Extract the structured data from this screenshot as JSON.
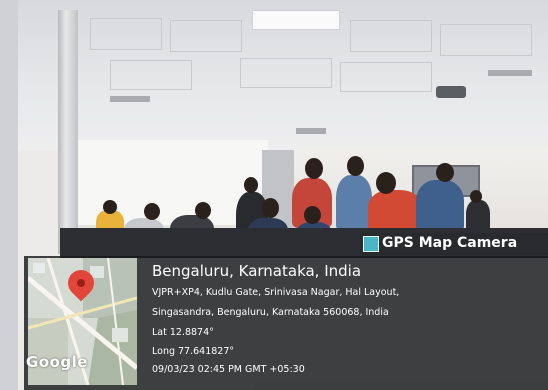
{
  "watermark": {
    "label": "GPS Map Camera"
  },
  "location": {
    "title": "Bengaluru, Karnataka, India",
    "address_line1": "VJPR+XP4, Kudlu Gate, Srinivasa Nagar, Hal Layout,",
    "address_line2": "Singasandra, Bengaluru, Karnataka 560068, India",
    "lat": "Lat 12.8874°",
    "long": "Long 77.641827°",
    "datetime": "09/03/23 02:45 PM GMT +05:30"
  },
  "map": {
    "attribution": "Google",
    "marker_icon": "map-pin-icon"
  },
  "colors": {
    "overlay": "#16181b",
    "pin": "#e2463b",
    "watermark_icon": "#4bb6c8"
  }
}
